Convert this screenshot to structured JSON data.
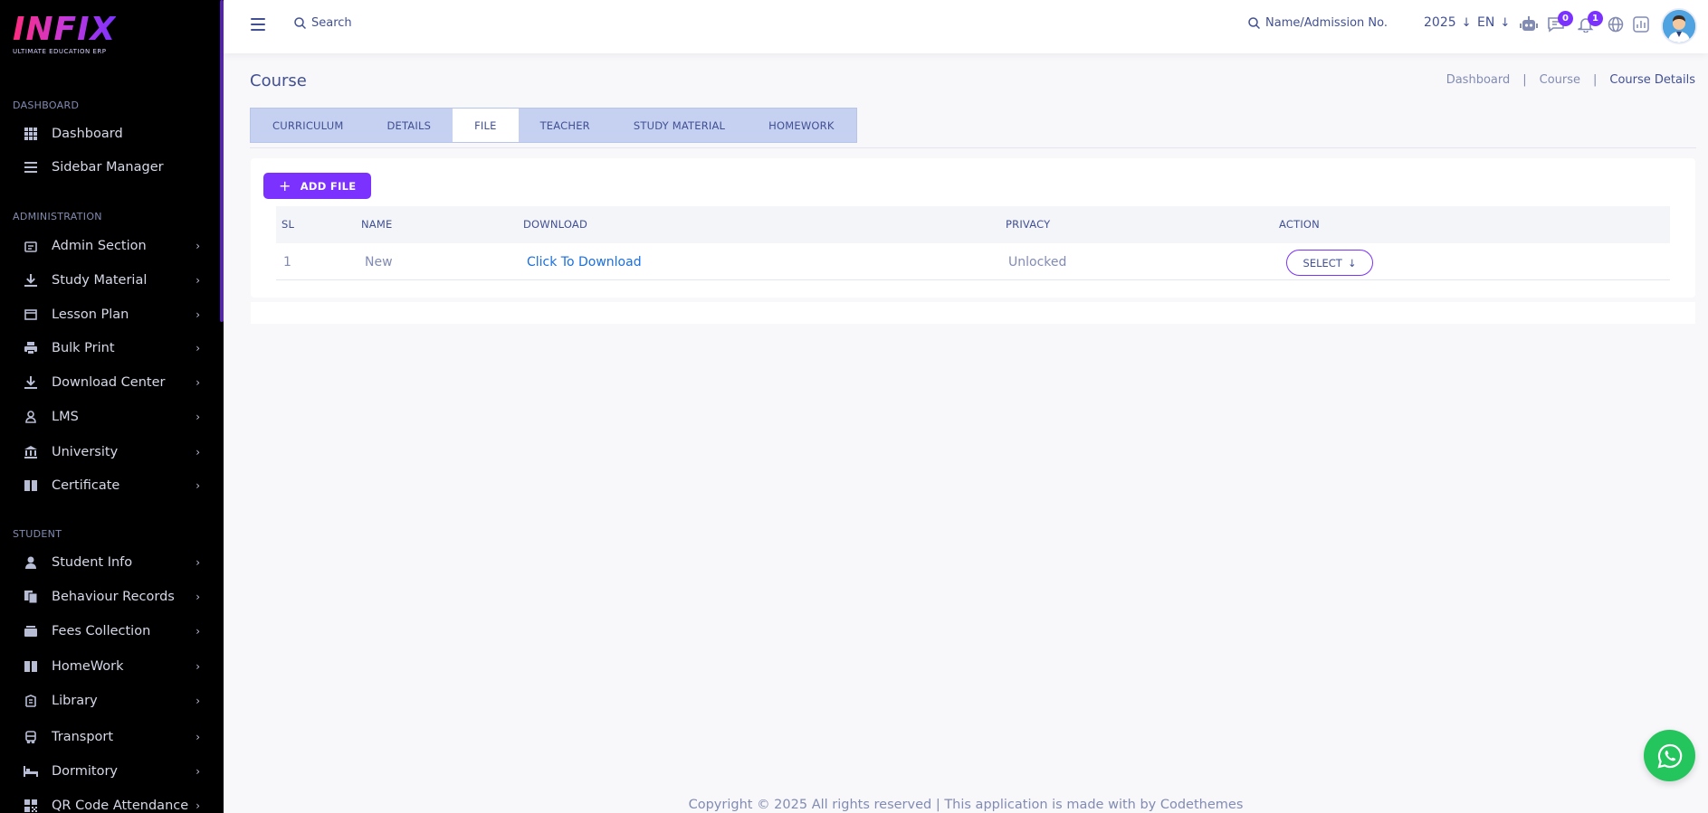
{
  "brand": {
    "name": "INFIX",
    "tagline": "ULTIMATE EDUCATION ERP"
  },
  "sidebar": {
    "sections": [
      {
        "label": "DASHBOARD",
        "items": [
          {
            "label": "Dashboard",
            "icon": "dashboard-grid-icon",
            "chevron": false
          },
          {
            "label": "Sidebar Manager",
            "icon": "menu-lines-icon",
            "chevron": false
          }
        ]
      },
      {
        "label": "ADMINISTRATION",
        "items": [
          {
            "label": "Admin Section",
            "icon": "admin-icon",
            "chevron": true
          },
          {
            "label": "Study Material",
            "icon": "download-icon",
            "chevron": true
          },
          {
            "label": "Lesson Plan",
            "icon": "lesson-plan-icon",
            "chevron": true
          },
          {
            "label": "Bulk Print",
            "icon": "printer-icon",
            "chevron": true
          },
          {
            "label": "Download Center",
            "icon": "download-icon",
            "chevron": true
          },
          {
            "label": "LMS",
            "icon": "lms-icon",
            "chevron": true
          },
          {
            "label": "University",
            "icon": "university-icon",
            "chevron": true
          },
          {
            "label": "Certificate",
            "icon": "book-icon",
            "chevron": true
          }
        ]
      },
      {
        "label": "STUDENT",
        "items": [
          {
            "label": "Student Info",
            "icon": "user-icon",
            "chevron": true
          },
          {
            "label": "Behaviour Records",
            "icon": "records-icon",
            "chevron": true
          },
          {
            "label": "Fees Collection",
            "icon": "money-icon",
            "chevron": true
          },
          {
            "label": "HomeWork",
            "icon": "book-icon",
            "chevron": true
          },
          {
            "label": "Library",
            "icon": "library-icon",
            "chevron": true
          },
          {
            "label": "Transport",
            "icon": "bus-icon",
            "chevron": true
          },
          {
            "label": "Dormitory",
            "icon": "bed-icon",
            "chevron": true
          },
          {
            "label": "QR Code Attendance",
            "icon": "qr-icon",
            "chevron": true
          }
        ]
      }
    ]
  },
  "topbar": {
    "search_placeholder": "Search",
    "admission_search": "Name/Admission No.",
    "year": "2025",
    "language": "EN",
    "messages_count": "0",
    "notifications_count": "1"
  },
  "page": {
    "title": "Course",
    "breadcrumb": [
      "Dashboard",
      "Course",
      "Course Details"
    ]
  },
  "tabs": [
    {
      "label": "CURRICULUM",
      "active": false
    },
    {
      "label": "DETAILS",
      "active": false
    },
    {
      "label": "FILE",
      "active": true
    },
    {
      "label": "TEACHER",
      "active": false
    },
    {
      "label": "STUDY MATERIAL",
      "active": false
    },
    {
      "label": "HOMEWORK",
      "active": false
    }
  ],
  "files": {
    "add_label": "ADD FILE",
    "columns": [
      "SL",
      "NAME",
      "DOWNLOAD",
      "PRIVACY",
      "ACTION"
    ],
    "rows": [
      {
        "sl": "1",
        "name": "New",
        "download": "Click To Download",
        "privacy": "Unlocked",
        "action": "SELECT"
      }
    ]
  },
  "footer": {
    "text": "Copyright © 2025 All rights reserved | This application is made with by Codethemes"
  },
  "colors": {
    "accent": "#7c32ff",
    "text": "#415094",
    "muted": "#828bb2",
    "link": "#1a6fe0",
    "whatsapp": "#25c55e"
  }
}
